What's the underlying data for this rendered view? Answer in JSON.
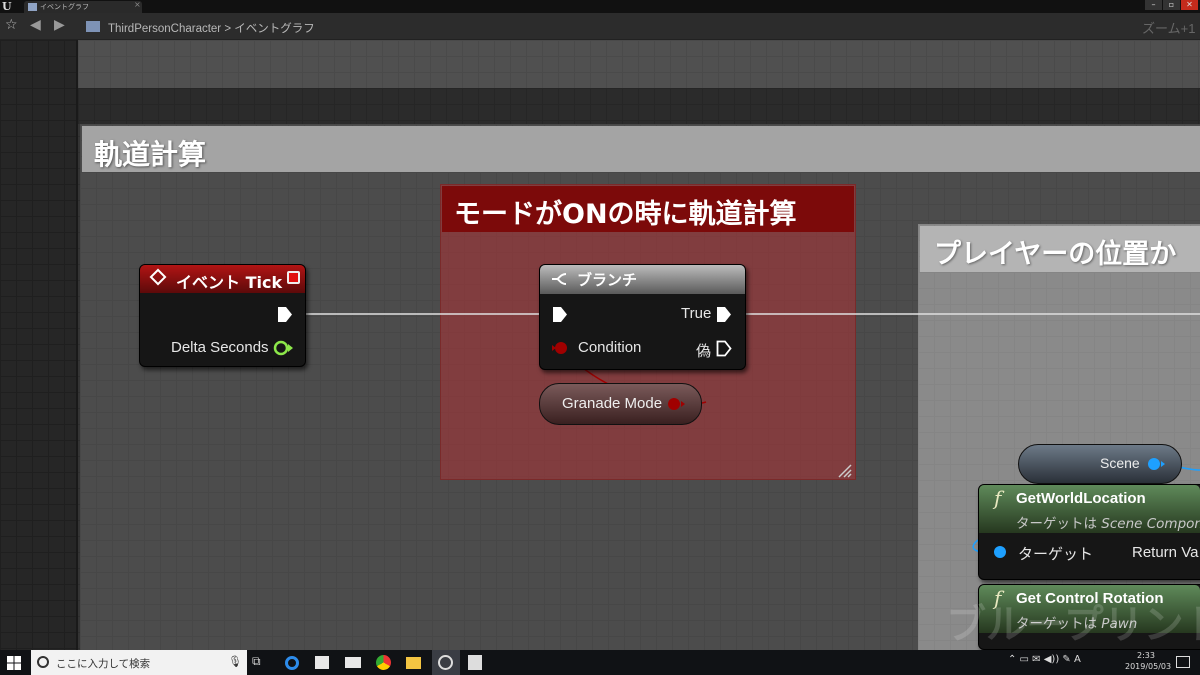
{
  "window": {
    "tab_title": "イベントグラフ",
    "tab_close": "×",
    "app_logo": "U",
    "minimize": "–",
    "maximize": "▫",
    "close": "✕"
  },
  "breadcrumb": {
    "blueprint": "ThirdPersonCharacter",
    "separator": ">",
    "graph": "イベントグラフ",
    "zoom_label": "ズーム+1"
  },
  "comments": {
    "main_title": "軌道計算",
    "mode_title": "モードがONの時に軌道計算",
    "player_title": "プレイヤーの位置か"
  },
  "event_tick": {
    "title": "イベント Tick",
    "output_delta": "Delta Seconds"
  },
  "branch": {
    "title": "ブランチ",
    "true_label": "True",
    "false_label": "偽",
    "condition_label": "Condition"
  },
  "granade_mode": {
    "label": "Granade Mode"
  },
  "scene": {
    "label": "Scene"
  },
  "get_world_location": {
    "title": "GetWorldLocation",
    "subtitle_prefix": "ターゲットは ",
    "subtitle_target": "Scene Compon",
    "input_target": "ターゲット",
    "output_return": "Return Va"
  },
  "get_control_rotation": {
    "title": "Get Control Rotation",
    "subtitle_prefix": "ターゲットは ",
    "subtitle_target": "Pawn"
  },
  "watermark": "ブループリント",
  "taskbar": {
    "search_placeholder": "ここに入力して検索",
    "time": "2:33",
    "date": "2019/05/03",
    "tray": "⌃ ▭ ✉ ◀)) ✎ A"
  },
  "colors": {
    "event_header": "#b21414",
    "branch_header": "#9a9a9a",
    "mode_comment": "#7c0a0a",
    "function_header": "#5f8a5a",
    "exec_pin": "#ffffff",
    "bool_pin": "#a00000",
    "object_pin": "#1ea0ff",
    "float_pin": "#8de84a"
  }
}
